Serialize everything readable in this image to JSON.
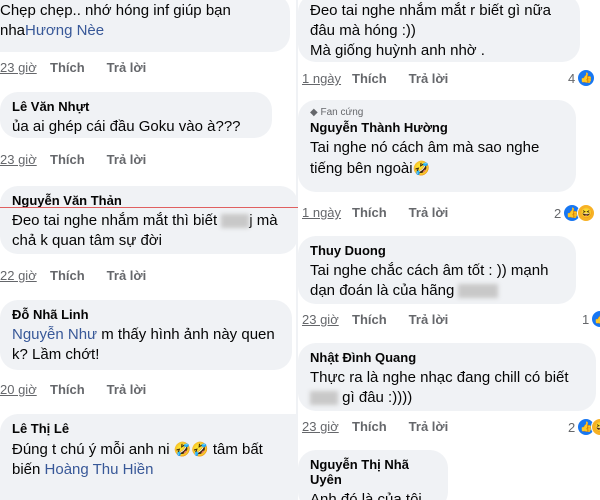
{
  "left": {
    "c1": {
      "text_a": "Chẹp chẹp.. nhớ hóng inf giúp bạn",
      "text_b": "nha",
      "mention": "Hương Nèe",
      "time": "23 giờ"
    },
    "c2": {
      "name": "Lê Văn Nhựt",
      "text": "ủa ai ghép cái đầu Goku vào à???",
      "time": "23 giờ"
    },
    "c3": {
      "name": "Nguyễn Văn Thản",
      "text_a": "Đeo tai nghe nhắm mắt thì biết",
      "text_b": "j mà",
      "text_c": "chả k quan tâm sự đời",
      "time": "22 giờ"
    },
    "c4": {
      "name": "Đỗ Nhã Linh",
      "mention": "Nguyễn Như",
      "text_a": " m thấy hình ảnh này quen",
      "text_b": "k? Lầm chớt!",
      "time": "20 giờ"
    },
    "c5": {
      "name": "Lê Thị Lê",
      "text_a": "Đúng t chú ý mỗi anh ni",
      "text_b": "tâm bất",
      "text_c": "biến ",
      "mention": "Hoàng Thu Hiền",
      "emoji": "🤣🤣"
    }
  },
  "right": {
    "c1": {
      "text_a": "Đeo tai nghe nhắm mắt r biết gì nữa",
      "text_b": "đâu mà hóng :))",
      "text_c": "Mà giống huỳnh anh nhờ .",
      "time": "1 ngày",
      "count": "4"
    },
    "c2": {
      "badge": "Fan cứng",
      "name": "Nguyễn Thành Hường",
      "text_a": "Tai nghe nó cách âm mà sao nghe",
      "text_b": "tiếng bên ngoài",
      "emoji": "🤣",
      "time": "1 ngày",
      "count": "2"
    },
    "c3": {
      "name": "Thuy Duong",
      "text_a": "Tai nghe chắc cách âm tốt : )) mạnh",
      "text_b": "dạn đoán là của hãng",
      "time": "23 giờ",
      "count": "1"
    },
    "c4": {
      "name": "Nhật Đình Quang",
      "text_a": "Thực ra là nghe nhạc đang chill có biết",
      "text_b": "gì đâu :))))",
      "time": "23 giờ",
      "count": "2"
    },
    "c5": {
      "name": "Nguyễn Thị Nhã Uyên",
      "text": "Anh đó là của tôi"
    }
  },
  "labels": {
    "like": "Thích",
    "reply": "Trả lời"
  },
  "icons": {
    "like": "thumbs-up-icon",
    "haha": "laughing-face-icon",
    "fan": "diamond-icon"
  },
  "colors": {
    "bubble": "#f0f2f5",
    "mention": "#385898",
    "like": "#1877f2",
    "meta": "#65676b"
  }
}
